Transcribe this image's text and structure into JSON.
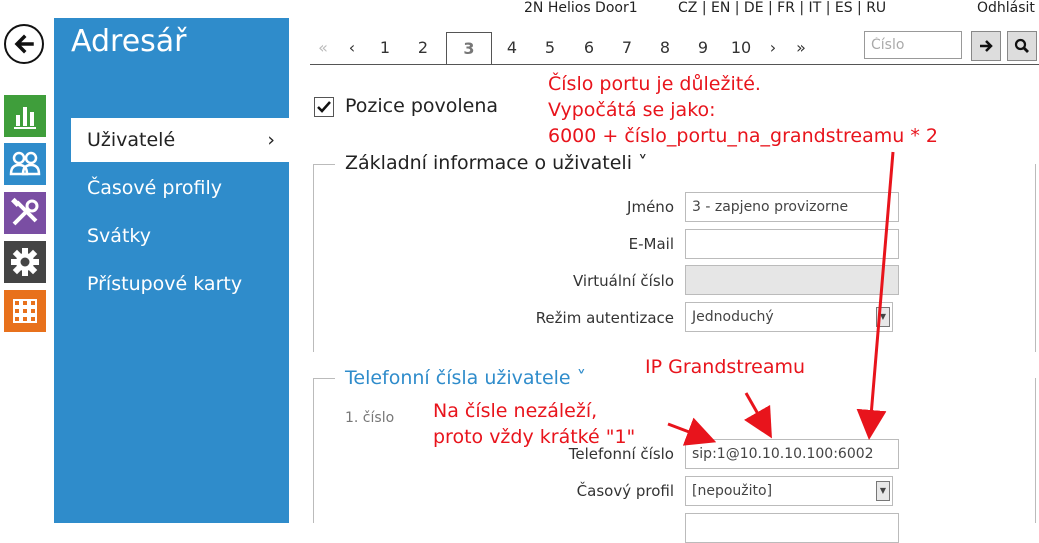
{
  "topbar": {
    "device_name": "2N Helios Door1",
    "languages": "CZ | EN | DE | FR | IT | ES | RU",
    "logout": "Odhlásit"
  },
  "sidebar": {
    "title": "Adresář",
    "items": [
      {
        "label": "Uživatelé",
        "active": true
      },
      {
        "label": "Časové profily"
      },
      {
        "label": "Svátky"
      },
      {
        "label": "Přístupové karty"
      }
    ],
    "rail_icons": [
      "back-arrow-icon",
      "statistics-icon",
      "users-icon",
      "tools-icon",
      "settings-icon",
      "apps-grid-icon"
    ],
    "rail_colors": {
      "green": "#3f9e3b",
      "blue": "#2f8ccb",
      "purple": "#7a4ea3",
      "gray": "#444444",
      "orange": "#e8711c"
    }
  },
  "pagination": {
    "first": "«",
    "prev": "‹",
    "next": "›",
    "last": "»",
    "pages": [
      "1",
      "2",
      "3",
      "4",
      "5",
      "6",
      "7",
      "8",
      "9",
      "10"
    ],
    "current": "3",
    "search_placeholder": "Číslo"
  },
  "form": {
    "position_enabled_label": "Pozice povolena",
    "position_enabled": true,
    "basic_section": {
      "title": "Základní informace o uživateli ˅",
      "name_label": "Jméno",
      "name_value": "3 - zapjeno provizorne",
      "email_label": "E-Mail",
      "email_value": "",
      "virtual_label": "Virtuální číslo",
      "virtual_value": "",
      "auth_label": "Režim autentizace",
      "auth_value": "Jednoduchý"
    },
    "phones_section": {
      "title": "Telefonní čísla uživatele ˅",
      "number_index": "1. číslo",
      "phone_label": "Telefonní číslo",
      "phone_value": "sip:1@10.10.10.100:6002",
      "profile_label": "Časový profil",
      "profile_value": "[nepoužito]"
    }
  },
  "annotations": {
    "port_note_line1": "Číslo portu je důležité.",
    "port_note_line2": "Vypočátá se jako:",
    "port_note_line3": "6000 + číslo_portu_na_grandstreamu * 2",
    "ip_note": "IP Grandstreamu",
    "number_note_line1": "Na čísle nezáleží,",
    "number_note_line2": "proto vždy krátké \"1\"",
    "color": "#e8141c"
  }
}
